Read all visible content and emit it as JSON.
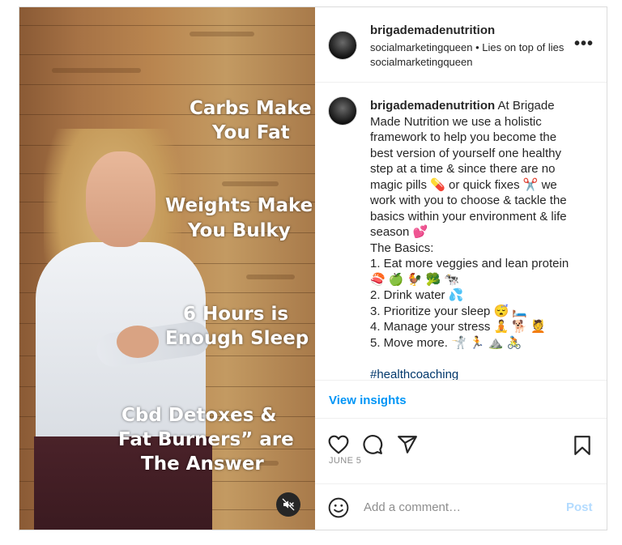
{
  "media": {
    "overlay_lines": [
      "Carbs Make",
      "You Fat",
      "Weights Make",
      "You Bulky",
      "6 Hours is",
      "Enough Sleep",
      "Cbd Detoxes &",
      "Fat Burners” are",
      "The Answer"
    ],
    "mute_icon": "speaker-muted-icon"
  },
  "header": {
    "username": "brigademadenutrition",
    "subtitle": "socialmarketingqueen • Lies on top of lies socialmarketingqueen",
    "more_icon": "•••"
  },
  "caption": {
    "username": "brigademadenutrition",
    "lines": [
      "At Brigade",
      "Made Nutrition we use a holistic",
      "framework to help you become the",
      "best version of yourself one healthy",
      "step at a time & since there are no",
      "magic pills 💊 or quick fixes ✂️ we",
      "work with you to choose & tackle the",
      "basics within your environment & life",
      "season 💕",
      "The Basics:",
      "1. Eat more veggies and lean protein",
      "🍣 🍏 🐓 🥦 🐄",
      "2. Drink water 💦",
      "3. Prioritize your sleep 😴 🛏️",
      "4. Manage your stress 🧘 🐕 💆",
      "5. Move more. 🤺 🏃 ⛰️ 🚴",
      "",
      "#healthcoaching"
    ]
  },
  "insights": {
    "label": "View insights"
  },
  "actions": {
    "like_icon": "heart-icon",
    "comment_icon": "comment-icon",
    "share_icon": "send-icon",
    "save_icon": "bookmark-icon",
    "date": "JUNE 5"
  },
  "comment": {
    "emoji_icon": "smiley-icon",
    "placeholder": "Add a comment…",
    "post_label": "Post"
  },
  "colors": {
    "link": "#0095f6",
    "hashtag": "#00376b",
    "muted": "#8e8e8e",
    "post_disabled": "#b3dbff"
  }
}
